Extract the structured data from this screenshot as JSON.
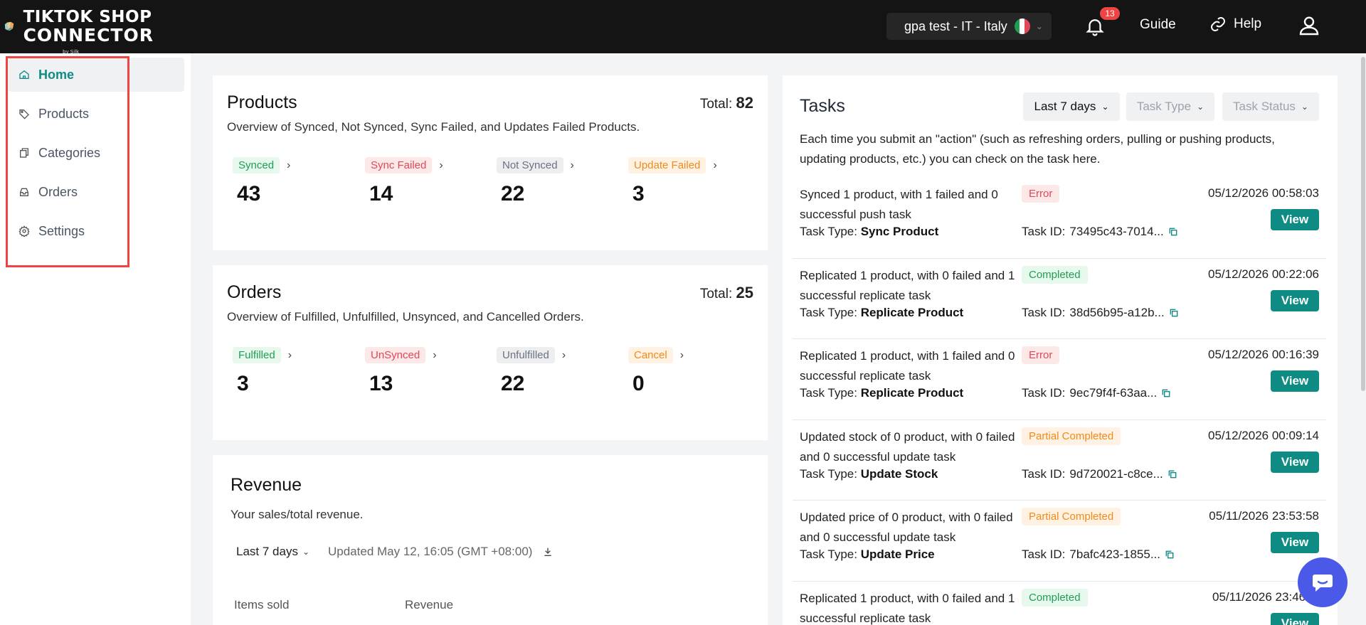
{
  "brand": {
    "line1": "TIKTOK SHOP",
    "line2": "CONNECTOR",
    "line3": "by Silk"
  },
  "header": {
    "store_label": "gpa test - IT  -  Italy",
    "notification_count": "13",
    "guide_label": "Guide",
    "help_label": "Help"
  },
  "sidebar": {
    "items": [
      {
        "label": "Home",
        "icon": "home-icon"
      },
      {
        "label": "Products",
        "icon": "tag-icon"
      },
      {
        "label": "Categories",
        "icon": "copy-icon"
      },
      {
        "label": "Orders",
        "icon": "inbox-icon"
      },
      {
        "label": "Settings",
        "icon": "gear-icon"
      }
    ]
  },
  "products": {
    "title": "Products",
    "total_label": "Total:",
    "total": "82",
    "subtitle": "Overview of Synced, Not Synced, Sync Failed, and Updates Failed Products.",
    "stats": [
      {
        "label": "Synced",
        "value": "43"
      },
      {
        "label": "Sync Failed",
        "value": "14"
      },
      {
        "label": "Not Synced",
        "value": "22"
      },
      {
        "label": "Update Failed",
        "value": "3"
      }
    ]
  },
  "orders": {
    "title": "Orders",
    "total_label": "Total:",
    "total": "25",
    "subtitle": "Overview of Fulfilled, Unfulfilled, Unsynced, and Cancelled Orders.",
    "stats": [
      {
        "label": "Fulfilled",
        "value": "3"
      },
      {
        "label": "UnSynced",
        "value": "13"
      },
      {
        "label": "Unfulfilled",
        "value": "22"
      },
      {
        "label": "Cancel",
        "value": "0"
      }
    ]
  },
  "revenue": {
    "title": "Revenue",
    "subtitle": "Your sales/total revenue.",
    "range": "Last 7 days",
    "updated": "Updated May 12, 16:05 (GMT +08:00)",
    "col_items": "Items sold",
    "col_revenue": "Revenue"
  },
  "tasks": {
    "title": "Tasks",
    "filter_range": "Last 7 days",
    "filter_type": "Task Type",
    "filter_status": "Task Status",
    "description": "Each time you submit an \"action\" (such as refreshing orders, pulling or pushing products, updating products, etc.) you can check on the task here.",
    "type_label": "Task Type:",
    "id_label": "Task ID:",
    "view_label": "View",
    "items": [
      {
        "desc": "Synced 1 product, with 1 failed and 0 successful push task",
        "status": "Error",
        "date": "05/12/2026 00:58:03",
        "type": "Sync Product",
        "id": "73495c43-7014..."
      },
      {
        "desc": "Replicated 1 product, with 0 failed and 1 successful replicate task",
        "status": "Completed",
        "date": "05/12/2026 00:22:06",
        "type": "Replicate Product",
        "id": "38d56b95-a12b..."
      },
      {
        "desc": "Replicated 1 product, with 1 failed and 0 successful replicate task",
        "status": "Error",
        "date": "05/12/2026 00:16:39",
        "type": "Replicate Product",
        "id": "9ec79f4f-63aa..."
      },
      {
        "desc": "Updated stock of 0 product, with 0 failed and 0 successful update task",
        "status": "Partial Completed",
        "date": "05/12/2026 00:09:14",
        "type": "Update Stock",
        "id": "9d720021-c8ce..."
      },
      {
        "desc": "Updated price of 0 product, with 0 failed and 0 successful update task",
        "status": "Partial Completed",
        "date": "05/11/2026 23:53:58",
        "type": "Update Price",
        "id": "7bafc423-1855..."
      },
      {
        "desc": "Replicated 1 product, with 0 failed and 1 successful replicate task",
        "status": "Completed",
        "date": "05/11/2026 23:46:..."
      }
    ]
  },
  "colors": {
    "accent": "#0e8c84",
    "topbar": "#141414",
    "chat": "#4a59e8"
  }
}
